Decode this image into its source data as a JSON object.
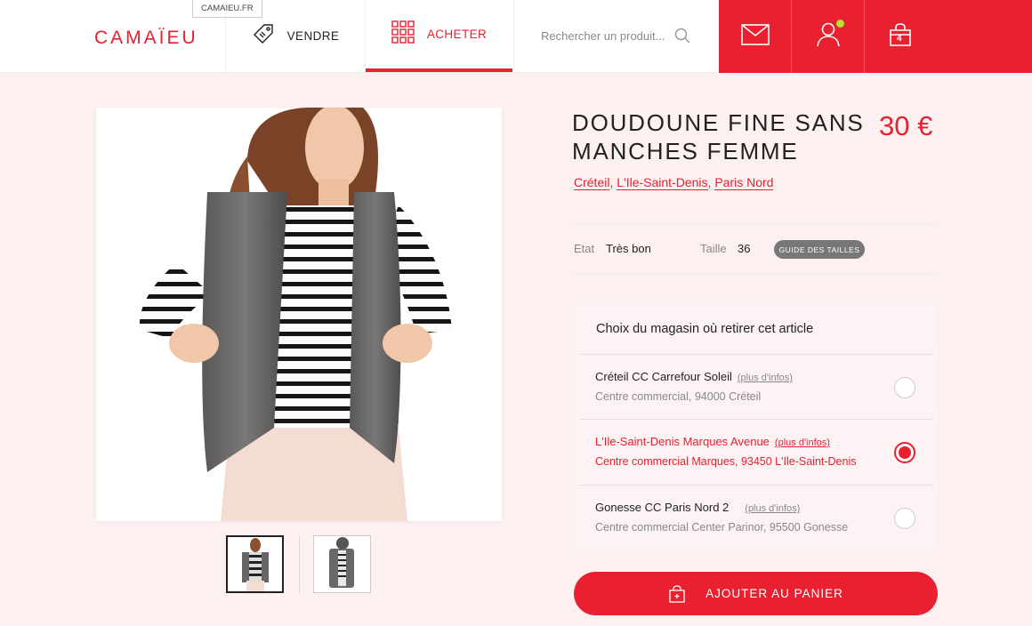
{
  "header": {
    "logo": "CAMAÏEU",
    "site_tag": "CAMAIEU.FR",
    "nav": [
      {
        "label": "VENDRE",
        "icon": "tag-icon"
      },
      {
        "label": "ACHETER",
        "icon": "grid-icon"
      }
    ],
    "search_placeholder": "Rechercher un produit...",
    "cart_count": "4"
  },
  "product": {
    "title": "DOUDOUNE FINE SANS MANCHES FEMME",
    "price": "30 €",
    "locations": [
      "Créteil",
      "L'Ile-Saint-Denis",
      "Paris Nord"
    ],
    "etat_label": "Etat",
    "etat_value": "Très bon",
    "taille_label": "Taille",
    "taille_value": "36",
    "size_guide": "GUIDE DES TAILLES"
  },
  "stores": {
    "title": "Choix du magasin où retirer cet article",
    "info_label": "(plus d'infos)",
    "items": [
      {
        "name": "Créteil CC Carrefour Soleil",
        "address": "Centre commercial, 94000 Créteil",
        "selected": false
      },
      {
        "name": "L'Ile-Saint-Denis Marques Avenue",
        "address": "Centre commercial Marques, 93450 L'Ile-Saint-Denis",
        "selected": true
      },
      {
        "name": "Gonesse CC Paris Nord 2",
        "address": "Centre commercial Center Parinor, 95500 Gonesse",
        "selected": false
      }
    ]
  },
  "cta": {
    "label": "AJOUTER AU PANIER"
  },
  "colors": {
    "accent": "#e8202f",
    "background": "#fdf0f1",
    "notification": "#b8e23a"
  }
}
